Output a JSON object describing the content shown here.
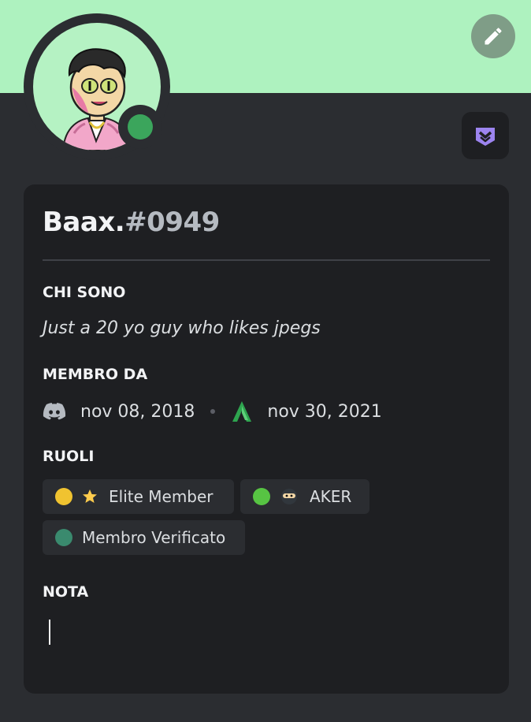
{
  "profile": {
    "name": "Baax.",
    "discriminator": "#0949"
  },
  "icons": {
    "edit": "pencil-icon",
    "badge": "hypesquad-badge-icon",
    "discord": "discord-logo-icon",
    "server": "server-logo-icon",
    "star": "star-icon",
    "ninja": "ninja-emoji-icon"
  },
  "colors": {
    "banner": "#aef2bf",
    "status_online": "#3ba55c",
    "badge_purple": "#9c84ef",
    "card_bg": "#1e1f22"
  },
  "about": {
    "title": "CHI SONO",
    "text": "Just a 20 yo guy who likes jpegs"
  },
  "member_since": {
    "title": "MEMBRO DA",
    "discord_date": "nov 08, 2018",
    "server_date": "nov 30, 2021"
  },
  "roles": {
    "title": "RUOLI",
    "items": [
      {
        "label": "Elite Member",
        "color": "#f0c330"
      },
      {
        "label": "AKER",
        "color": "#57c443"
      },
      {
        "label": "Membro Verificato",
        "color": "#3a8a6e"
      }
    ]
  },
  "note": {
    "title": "NOTA",
    "value": ""
  }
}
